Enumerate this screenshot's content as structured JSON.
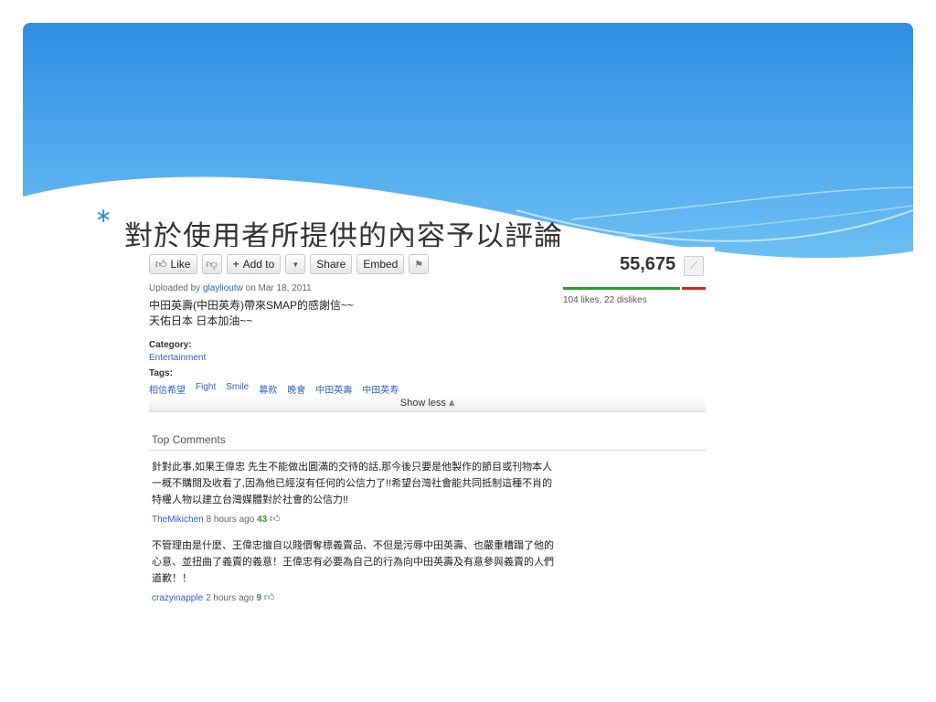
{
  "slide": {
    "bullet": "∗",
    "title": "對於使用者所提供的內容予以評論"
  },
  "toolbar": {
    "like_label": "Like",
    "add_to_label": "Add to",
    "share_label": "Share",
    "embed_label": "Embed"
  },
  "stats": {
    "view_count": "55,675",
    "likes_dislikes": "104 likes, 22 dislikes",
    "like_fraction": 0.82
  },
  "video": {
    "uploaded_prefix": "Uploaded by",
    "uploader": "glaylioutw",
    "uploaded_suffix": "on Mar 18, 2011",
    "description_line1": "中田英壽(中田英寿)帶來SMAP的感謝信~~",
    "description_line2": "天佑日本 日本加油~~",
    "category_label": "Category:",
    "category": "Entertainment",
    "tags_label": "Tags:",
    "tags": [
      "相信希望",
      "Fight",
      "Smile",
      "募款",
      "晚會",
      "中田英壽",
      "中田英寿"
    ],
    "show_less": "Show less ⩓"
  },
  "comments": {
    "heading": "Top Comments",
    "items": [
      {
        "text": "針對此事,如果王偉忠 先生不能做出圓滿的交待的話,那今後只要是他製作的節目或刊物本人一概不購閱及收看了,因為他已經沒有任何的公信力了!!希望台灣社會能共同抵制這種不肖的特權人物以建立台灣媒體對於社會的公信力!!",
        "author": "TheMikichen",
        "time": "8 hours ago",
        "score": "43"
      },
      {
        "text": "不管理由是什麼、王偉忠擅自以賤價奪標義賣品、不但是污辱中田英壽、也嚴重糟蹋了他的心意、並扭曲了義賣的義意！王偉忠有必要為自己的行為向中田英壽及有意參與義賣的人們道歉！！",
        "author": "crazyinapple",
        "time": "2 hours ago",
        "score": "9"
      }
    ]
  },
  "colors": {
    "header_blue": "#3b9ae6",
    "link_blue": "#2a62c8",
    "like_green": "#2b9b2b",
    "dislike_red": "#dd2222"
  }
}
